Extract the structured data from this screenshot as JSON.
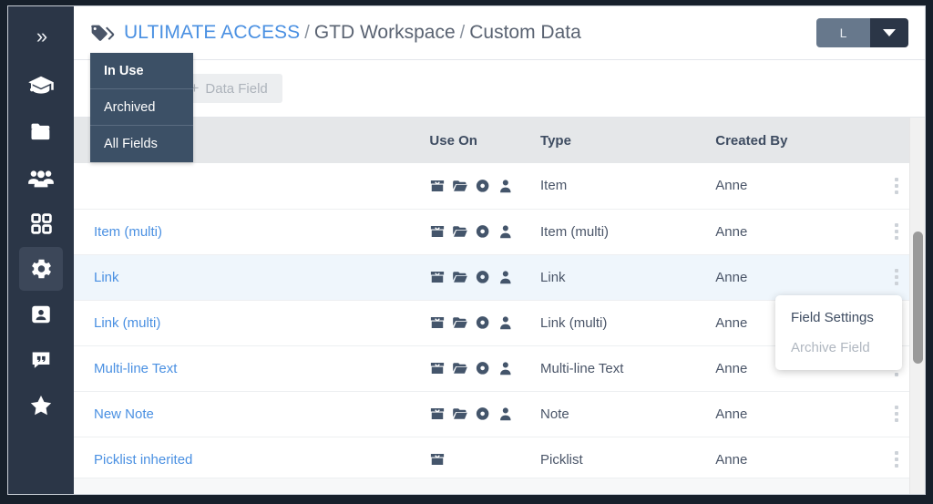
{
  "sidebar": {
    "items": [
      {
        "name": "expand-toggle",
        "icon": "chevrons-right-icon",
        "label": "»",
        "active": false
      },
      {
        "name": "learning",
        "icon": "graduation-cap-icon",
        "label": "",
        "active": false
      },
      {
        "name": "files",
        "icon": "folder-icon",
        "label": "",
        "active": false
      },
      {
        "name": "people",
        "icon": "users-group-icon",
        "label": "",
        "active": false
      },
      {
        "name": "apps",
        "icon": "grid-apps-icon",
        "label": "",
        "active": false
      },
      {
        "name": "settings",
        "icon": "gear-icon",
        "label": "",
        "active": true
      },
      {
        "name": "contacts",
        "icon": "contact-card-icon",
        "label": "",
        "active": false
      },
      {
        "name": "notes",
        "icon": "quote-bubble-icon",
        "label": "",
        "active": false
      },
      {
        "name": "favorites",
        "icon": "star-icon",
        "label": "",
        "active": false
      }
    ]
  },
  "topbar": {
    "tag_icon": "tag-icon",
    "breadcrumb": {
      "root": "ULTIMATE ACCESS",
      "separator": "/",
      "items": [
        "GTD Workspace",
        "Custom Data"
      ]
    },
    "user_button": {
      "initial": "L",
      "caret_icon": "caret-down-icon"
    }
  },
  "toolbar": {
    "filter_button": {
      "label": "In Use",
      "caret_icon": "caret-down-icon"
    },
    "add_field_button": {
      "plus_icon": "plus-icon",
      "label": "Data Field",
      "disabled": true
    }
  },
  "filter_menu": {
    "open": true,
    "options": [
      {
        "label": "In Use",
        "selected": true
      },
      {
        "label": "Archived",
        "selected": false
      },
      {
        "label": "All Fields",
        "selected": false
      }
    ]
  },
  "table": {
    "columns": [
      "",
      "Use On",
      "Type",
      "Created By",
      ""
    ],
    "rows": [
      {
        "name": "",
        "use_on": [
          "box-icon",
          "open-folder-icon",
          "donut-icon",
          "person-icon"
        ],
        "type": "Item",
        "created_by": "Anne",
        "highlighted": false,
        "name_hidden": true
      },
      {
        "name": "Item (multi)",
        "use_on": [
          "box-icon",
          "open-folder-icon",
          "donut-icon",
          "person-icon"
        ],
        "type": "Item (multi)",
        "created_by": "Anne",
        "highlighted": false,
        "name_hidden": false
      },
      {
        "name": "Link",
        "use_on": [
          "box-icon",
          "open-folder-icon",
          "donut-icon",
          "person-icon"
        ],
        "type": "Link",
        "created_by": "Anne",
        "highlighted": true,
        "name_hidden": false
      },
      {
        "name": "Link (multi)",
        "use_on": [
          "box-icon",
          "open-folder-icon",
          "donut-icon",
          "person-icon"
        ],
        "type": "Link (multi)",
        "created_by": "Anne",
        "highlighted": false,
        "name_hidden": false
      },
      {
        "name": "Multi-line Text",
        "use_on": [
          "box-icon",
          "open-folder-icon",
          "donut-icon",
          "person-icon"
        ],
        "type": "Multi-line Text",
        "created_by": "Anne",
        "highlighted": false,
        "name_hidden": false
      },
      {
        "name": "New Note",
        "use_on": [
          "box-icon",
          "open-folder-icon",
          "donut-icon",
          "person-icon"
        ],
        "type": "Note",
        "created_by": "Anne",
        "highlighted": false,
        "name_hidden": false
      },
      {
        "name": "Picklist inherited",
        "use_on": [
          "box-icon"
        ],
        "type": "Picklist",
        "created_by": "Anne",
        "highlighted": false,
        "name_hidden": false
      }
    ],
    "row_menu_icon": "kebab-vertical-icon"
  },
  "context_menu": {
    "open": true,
    "items": [
      {
        "label": "Field Settings",
        "disabled": false
      },
      {
        "label": "Archive Field",
        "disabled": true
      }
    ]
  },
  "scrollbar": {
    "orientation": "vertical",
    "visible": true
  },
  "cursor": {
    "icon": "pointing-hand-cursor"
  },
  "colors": {
    "sidebar_bg": "#2b3647",
    "sidebar_active": "#3c4759",
    "accent_link": "#4a90e2",
    "menu_bg": "#3c5066",
    "header_bg": "#e5e7e9",
    "row_highlight": "#eff6fc",
    "frame": "#17202b"
  }
}
